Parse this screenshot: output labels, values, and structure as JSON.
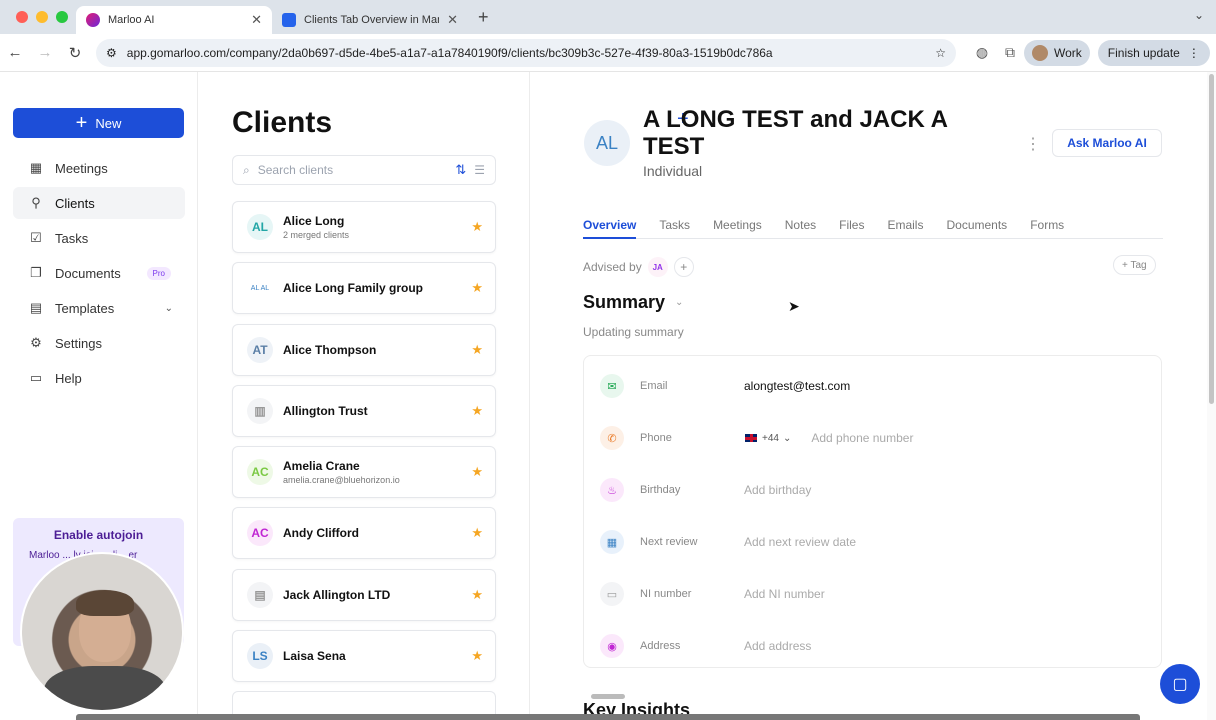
{
  "browser": {
    "tabs": [
      {
        "title": "Marloo AI",
        "active": true
      },
      {
        "title": "Clients Tab Overview in Marloo",
        "active": false
      }
    ],
    "url": "app.gomarloo.com/company/2da0b697-d5de-4be5-a1a7-a1a7840190f9/clients/bc309b3c-527e-4f39-80a3-1519b0dc786a",
    "profile_label": "Work",
    "finish_update_label": "Finish update"
  },
  "sidebar": {
    "new_label": "New",
    "items": [
      {
        "label": "Meetings",
        "icon": "calendar-icon"
      },
      {
        "label": "Clients",
        "icon": "person-icon"
      },
      {
        "label": "Tasks",
        "icon": "checkbox-icon"
      },
      {
        "label": "Documents",
        "icon": "documents-icon",
        "badge": "Pro"
      },
      {
        "label": "Templates",
        "icon": "template-icon"
      },
      {
        "label": "Settings",
        "icon": "gear-icon"
      },
      {
        "label": "Help",
        "icon": "help-icon"
      }
    ],
    "autojoin": {
      "title": "Enable autojoin",
      "text_visible": "Marloo ... ly join onli... er"
    }
  },
  "clients_list": {
    "title": "Clients",
    "search_placeholder": "Search clients",
    "clients": [
      {
        "initials": "AL",
        "name": "Alice Long",
        "sub": "2 merged clients",
        "color": "#22a6a6",
        "bg": "#e6f6f6"
      },
      {
        "initials": "AL AL",
        "name": "Alice Long Family group",
        "sub": "",
        "color": "#3b82c4",
        "bg": "#ffffff"
      },
      {
        "initials": "AT",
        "name": "Alice Thompson",
        "sub": "",
        "color": "#5b7fa6",
        "bg": "#eef2f7"
      },
      {
        "initials": "",
        "name": "Allington Trust",
        "sub": "",
        "color": "#999999",
        "bg": "#f3f4f6"
      },
      {
        "initials": "AC",
        "name": "Amelia Crane",
        "sub": "amelia.crane@bluehorizon.io",
        "color": "#7ac943",
        "bg": "#eef9e6"
      },
      {
        "initials": "AC",
        "name": "Andy Clifford",
        "sub": "",
        "color": "#c026d3",
        "bg": "#fbe8fb"
      },
      {
        "initials": "",
        "name": "Jack Allington LTD",
        "sub": "",
        "color": "#999999",
        "bg": "#f3f4f6"
      },
      {
        "initials": "LS",
        "name": "Laisa Sena",
        "sub": "",
        "color": "#3b82c4",
        "bg": "#eaf0f7"
      }
    ]
  },
  "detail": {
    "initials": "AL",
    "name": "A LONG TEST and JACK A TEST",
    "type": "Individual",
    "ask_label": "Ask Marloo AI",
    "tabs": [
      "Overview",
      "Tasks",
      "Meetings",
      "Notes",
      "Files",
      "Emails",
      "Documents",
      "Forms"
    ],
    "advised_by_label": "Advised by",
    "advisor_initials": "JA",
    "tag_label": "+ Tag",
    "summary_title": "Summary",
    "summary_status": "Updating summary",
    "fields": [
      {
        "label": "Email",
        "value": "alongtest@test.com",
        "placeholder": "",
        "icon": "mail-icon",
        "color": "#16a34a",
        "bg": "#e8f7ee"
      },
      {
        "label": "Phone",
        "value": "",
        "placeholder": "Add phone number",
        "icon": "phone-icon",
        "color": "#ea7c2a",
        "bg": "#fdf0e6",
        "prefix": "+44"
      },
      {
        "label": "Birthday",
        "value": "",
        "placeholder": "Add birthday",
        "icon": "cake-icon",
        "color": "#c026d3",
        "bg": "#fbe8fb"
      },
      {
        "label": "Next review",
        "value": "",
        "placeholder": "Add next review date",
        "icon": "calendar-icon",
        "color": "#3b82c4",
        "bg": "#e8f1fb"
      },
      {
        "label": "NI number",
        "value": "",
        "placeholder": "Add NI number",
        "icon": "id-card-icon",
        "color": "#999999",
        "bg": "#f3f4f6"
      },
      {
        "label": "Address",
        "value": "",
        "placeholder": "Add address",
        "icon": "pin-icon",
        "color": "#c026d3",
        "bg": "#fbe8fb"
      }
    ],
    "key_insights_title": "Key Insights"
  }
}
